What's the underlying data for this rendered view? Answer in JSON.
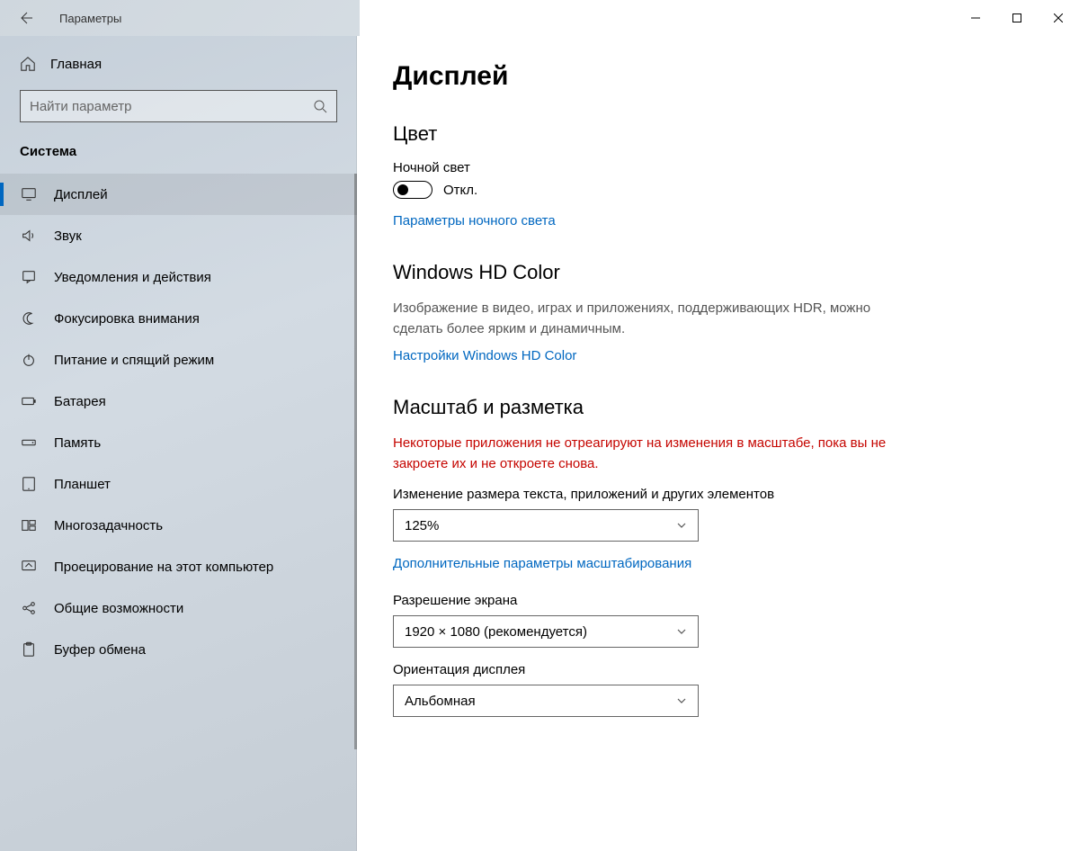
{
  "window": {
    "title": "Параметры"
  },
  "sidebar": {
    "home": "Главная",
    "search_placeholder": "Найти параметр",
    "category": "Система",
    "items": [
      {
        "icon": "display",
        "label": "Дисплей",
        "selected": true
      },
      {
        "icon": "sound",
        "label": "Звук"
      },
      {
        "icon": "notifications",
        "label": "Уведомления и действия"
      },
      {
        "icon": "focus",
        "label": "Фокусировка внимания"
      },
      {
        "icon": "power",
        "label": "Питание и спящий режим"
      },
      {
        "icon": "battery",
        "label": "Батарея"
      },
      {
        "icon": "storage",
        "label": "Память"
      },
      {
        "icon": "tablet",
        "label": "Планшет"
      },
      {
        "icon": "multitask",
        "label": "Многозадачность"
      },
      {
        "icon": "project",
        "label": "Проецирование на этот компьютер"
      },
      {
        "icon": "shared",
        "label": "Общие возможности"
      },
      {
        "icon": "clipboard",
        "label": "Буфер обмена"
      }
    ]
  },
  "page": {
    "title": "Дисплей",
    "color": {
      "heading": "Цвет",
      "night_light_label": "Ночной свет",
      "night_light_state": "Откл.",
      "night_light_link": "Параметры ночного света"
    },
    "hdcolor": {
      "heading": "Windows HD Color",
      "desc": "Изображение в видео, играх и приложениях, поддерживающих HDR, можно сделать более ярким и динамичным.",
      "link": "Настройки Windows HD Color"
    },
    "scale": {
      "heading": "Масштаб и разметка",
      "warning": "Некоторые приложения не отреагируют на изменения в масштабе, пока вы не закроете их и не откроете снова.",
      "scale_label": "Изменение размера текста, приложений и других элементов",
      "scale_value": "125%",
      "advanced_link": "Дополнительные параметры масштабирования",
      "resolution_label": "Разрешение экрана",
      "resolution_value": "1920 × 1080 (рекомендуется)",
      "orientation_label": "Ориентация дисплея",
      "orientation_value": "Альбомная"
    }
  }
}
